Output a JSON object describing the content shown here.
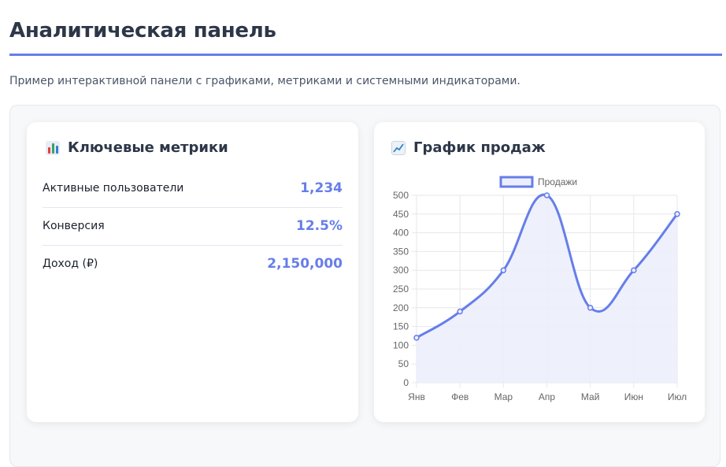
{
  "page": {
    "title": "Аналитическая панель",
    "description": "Пример интерактивной панели с графиками, метриками и системными индикаторами."
  },
  "metrics_card": {
    "title": "Ключевые метрики",
    "icon": "bar-chart-icon",
    "items": [
      {
        "label": "Активные пользователи",
        "value": "1,234"
      },
      {
        "label": "Конверсия",
        "value": "12.5%"
      },
      {
        "label": "Доход (₽)",
        "value": "2,150,000"
      }
    ]
  },
  "chart_card": {
    "title": "График продаж",
    "icon": "line-chart-icon"
  },
  "colors": {
    "accent": "#667eea",
    "fill": "#eceefc",
    "grid": "#e5e7eb",
    "tick": "#666666"
  },
  "chart_data": {
    "type": "line",
    "categories": [
      "Янв",
      "Фев",
      "Мар",
      "Апр",
      "Май",
      "Июн",
      "Июл"
    ],
    "series": [
      {
        "name": "Продажи",
        "values": [
          120,
          190,
          300,
          500,
          200,
          300,
          450
        ]
      }
    ],
    "ylim": [
      0,
      500
    ],
    "yticks": [
      0,
      50,
      100,
      150,
      200,
      250,
      300,
      350,
      400,
      450,
      500
    ],
    "grid": true,
    "legend": "top-center",
    "fill": true,
    "smooth": true
  }
}
